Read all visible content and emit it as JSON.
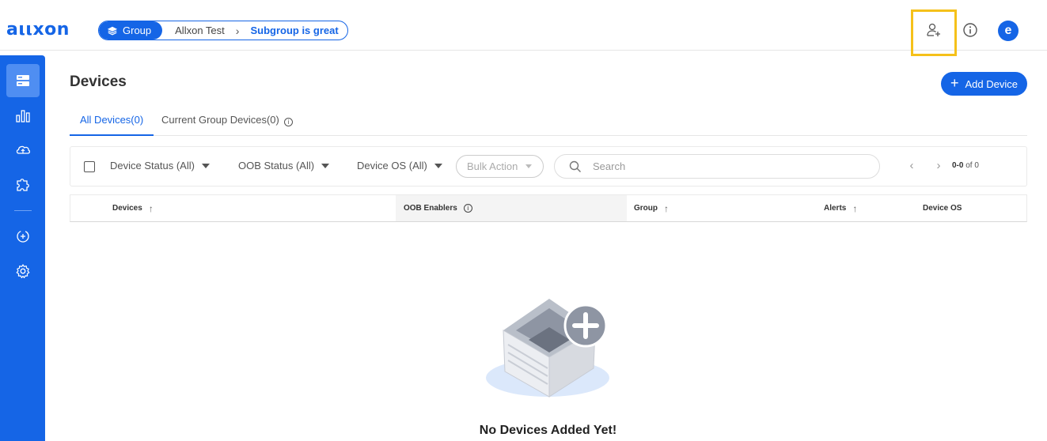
{
  "header": {
    "logo": "aιιxon",
    "breadcrumb": {
      "group_label": "Group",
      "items": [
        "Allxon Test"
      ],
      "current": "Subgroup is great"
    },
    "avatar_letter": "e"
  },
  "page": {
    "title": "Devices",
    "add_button": "Add Device",
    "tabs": [
      {
        "label": "All Devices(0)",
        "active": true
      },
      {
        "label": "Current Group Devices(0)",
        "active": false
      }
    ]
  },
  "filters": {
    "device_status": "Device Status (All)",
    "oob_status": "OOB Status (All)",
    "device_os": "Device OS (All)",
    "bulk_action": "Bulk Action",
    "search_placeholder": "Search",
    "pager_range": "0-0",
    "pager_total": "of 0"
  },
  "table": {
    "columns": [
      "Devices",
      "OOB Enablers",
      "Group",
      "Alerts",
      "Device OS"
    ]
  },
  "empty": {
    "message": "No Devices Added Yet!"
  },
  "colors": {
    "accent": "#1565e6",
    "highlight": "#f5c11a"
  },
  "icons": {
    "topbar": [
      "add-user-icon",
      "info-icon"
    ],
    "sidebar": [
      "devices-icon",
      "chart-icon",
      "cloud-sync-icon",
      "plugin-icon",
      "deploy-icon",
      "settings-icon"
    ]
  }
}
